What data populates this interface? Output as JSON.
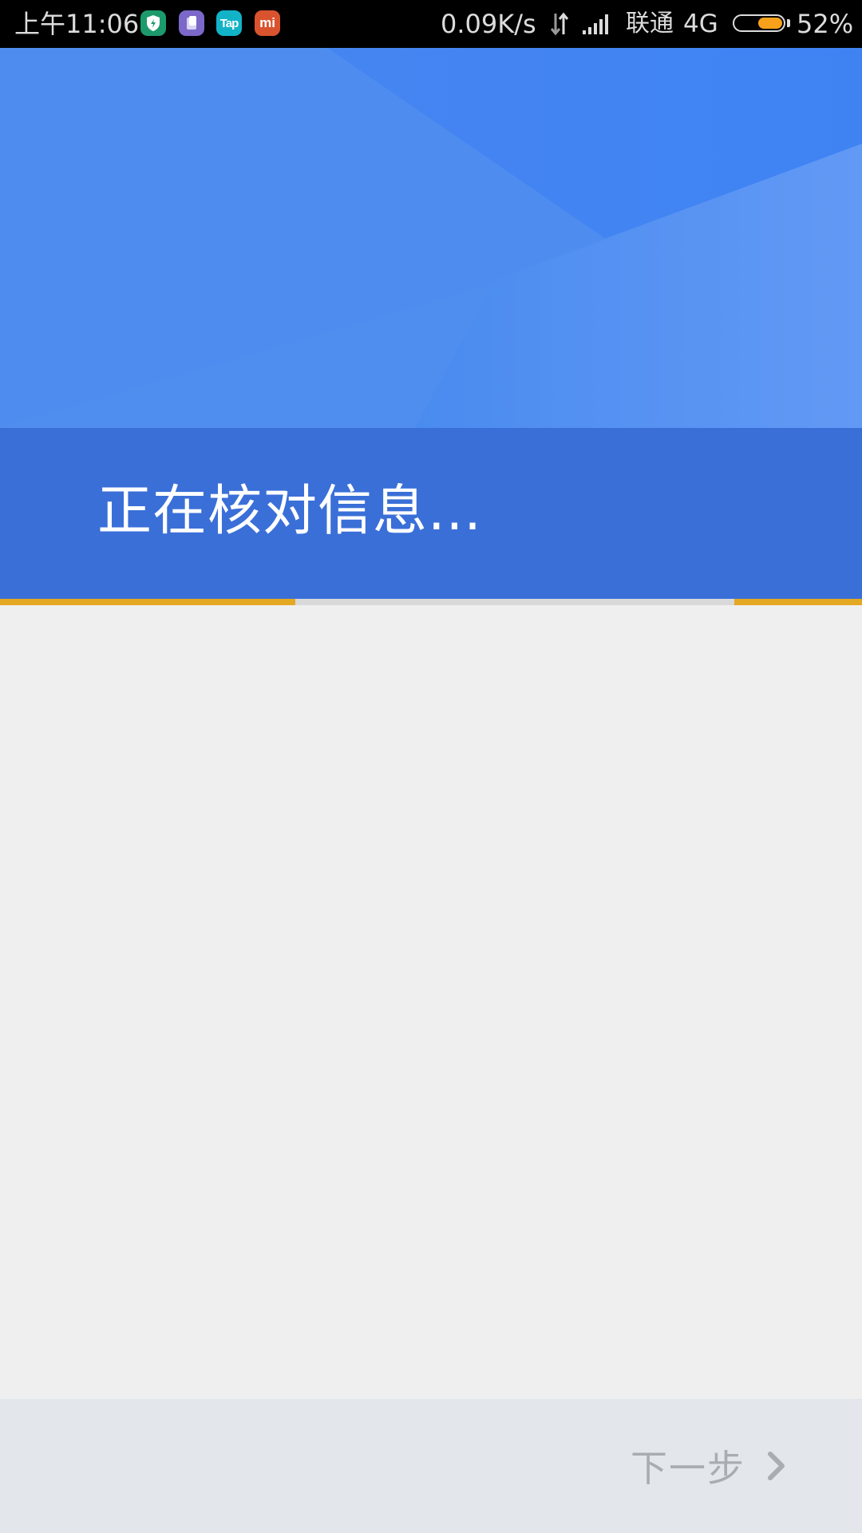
{
  "status_bar": {
    "time": "上午11:06",
    "notification_icons": [
      {
        "name": "shield-app-icon",
        "glyph": "⛨",
        "color": "#1d9a6c"
      },
      {
        "name": "purple-app-icon",
        "glyph": "▣",
        "color": "#7b68c9"
      },
      {
        "name": "tap-app-icon",
        "glyph": "Tap",
        "color": "#12b3c7"
      },
      {
        "name": "mi-app-icon",
        "glyph": "mi",
        "color": "#d9532f"
      }
    ],
    "network_speed": "0.09K/s",
    "carrier": "联通",
    "network_type": "4G",
    "battery_percent_text": "52%",
    "battery_level": 0.52
  },
  "header": {
    "title": "正在核对信息..."
  },
  "progress": {
    "style": "indeterminate",
    "color": "#e5a823",
    "track_color": "#d9d9d9"
  },
  "footer": {
    "next_label": "下一步",
    "next_icon": "chevron-right-icon"
  },
  "colors": {
    "header_blue": "#4a89ee",
    "title_band_blue": "#3a6fd8",
    "background": "#efefef",
    "footer_bg": "#e3e7eb",
    "disabled_text": "#a9adb1"
  }
}
